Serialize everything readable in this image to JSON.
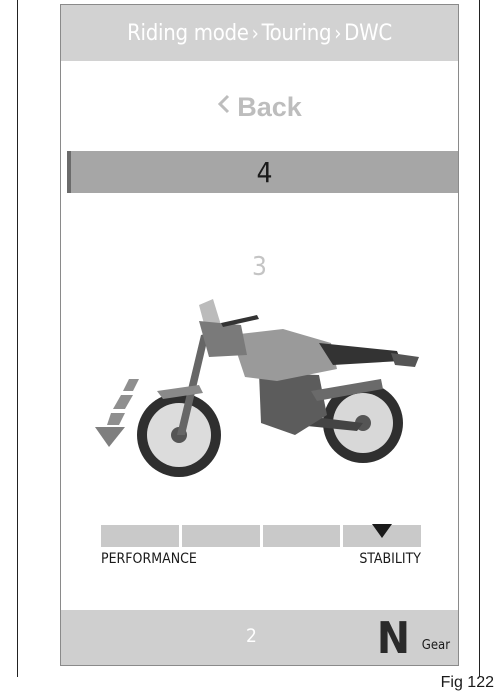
{
  "header": {
    "breadcrumb": [
      "Riding mode",
      "Touring",
      "DWC"
    ],
    "separator": "›"
  },
  "menu": {
    "back_label": "Back",
    "back_icon": "chevron-left-icon",
    "selected_value": "4",
    "next_value": "3"
  },
  "scale": {
    "segments": 4,
    "marker_segment": 4,
    "left_label": "PERFORMANCE",
    "right_label": "STABILITY"
  },
  "footer": {
    "value": "2",
    "gear_value": "N",
    "gear_label": "Gear"
  },
  "figure": {
    "caption": "Fig 122"
  },
  "colors": {
    "header_bg": "#d2d2d2",
    "selected_bg": "#a6a6a6",
    "segment_bg": "#c9c9c9"
  }
}
